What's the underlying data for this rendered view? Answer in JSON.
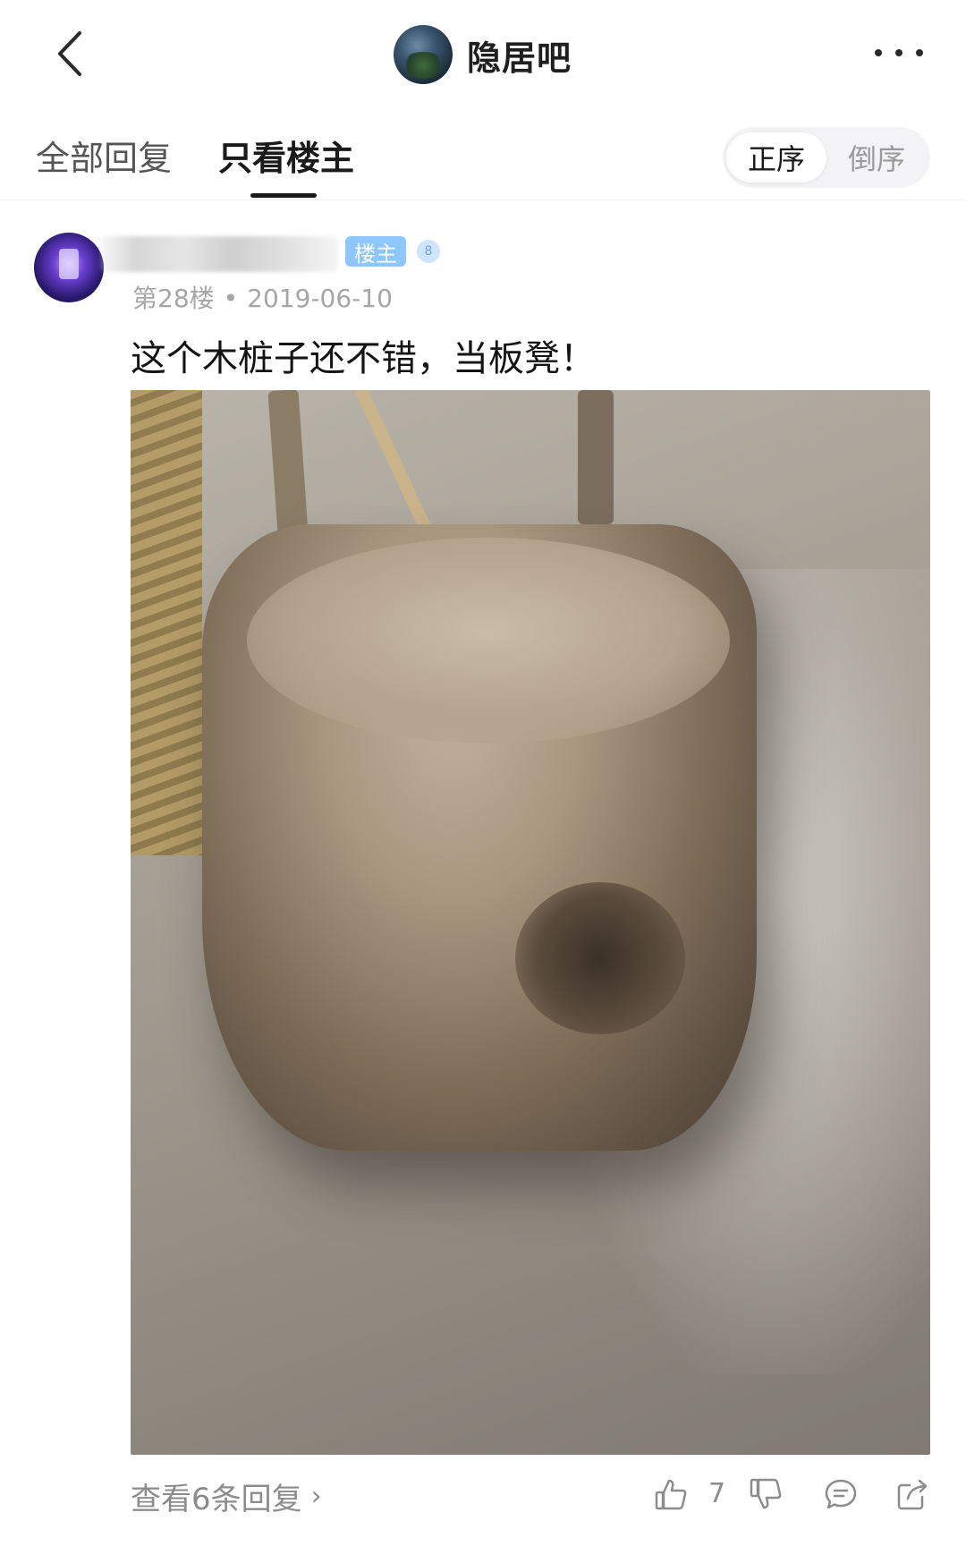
{
  "header": {
    "forum_name": "隐居吧"
  },
  "tabs": {
    "all_replies": "全部回复",
    "only_op": "只看楼主",
    "order_asc": "正序",
    "order_desc": "倒序"
  },
  "post": {
    "op_badge": "楼主",
    "level": "8",
    "floor": "第28楼",
    "separator": "•",
    "date": "2019-06-10",
    "text": "这个木桩子还不错，当板凳！"
  },
  "footer": {
    "view_replies": "查看6条回复",
    "like_count": "7"
  },
  "icons": [
    "back-arrow-icon",
    "more-icon",
    "like-icon",
    "dislike-icon",
    "comment-icon",
    "share-icon"
  ],
  "colors": {
    "op_badge_bg": "#8ec7ff",
    "text_primary": "#141414",
    "text_secondary": "#8c8c8c"
  }
}
